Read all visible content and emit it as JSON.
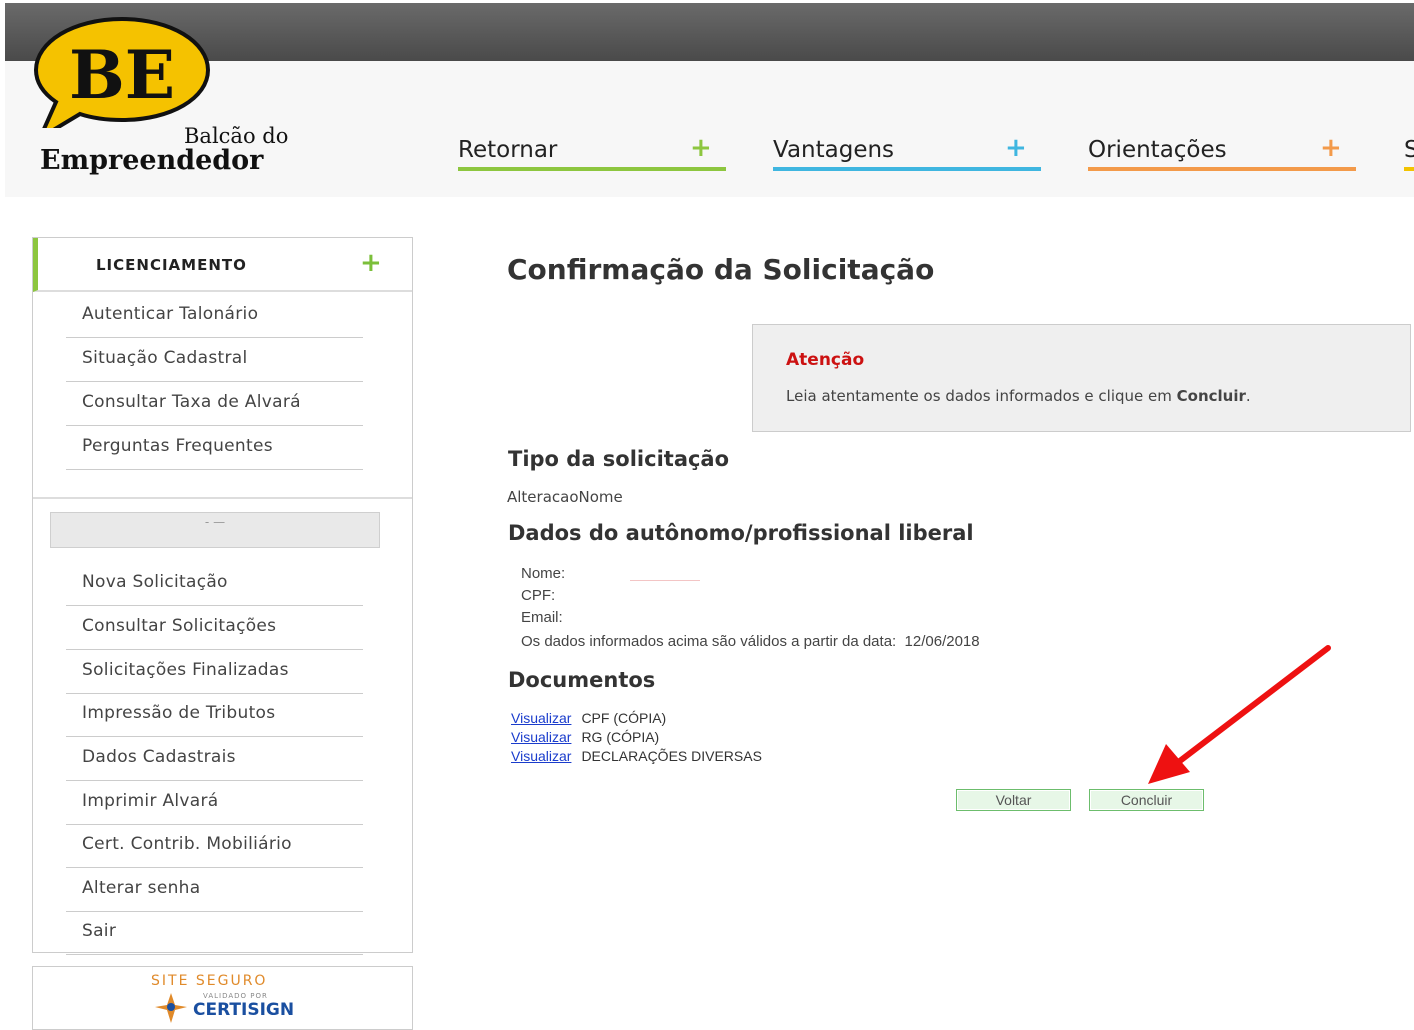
{
  "logo": {
    "mark": "BE",
    "line1": "Balcão do",
    "line2": "Empreendedor"
  },
  "nav": {
    "items": [
      {
        "label": "Retornar",
        "color": "#8dc63f"
      },
      {
        "label": "Vantagens",
        "color": "#3fb6e0"
      },
      {
        "label": "Orientações",
        "color": "#f39a4a"
      },
      {
        "label": "S",
        "color": "#f2c300"
      }
    ],
    "plus": "+"
  },
  "sidebar": {
    "title": "LICENCIAMENTO",
    "plus": "+",
    "top_items": [
      "Autenticar Talonário",
      "Situação Cadastral",
      "Consultar Taxa de Alvará",
      "Perguntas Frequentes"
    ],
    "grey_box_text": "- —",
    "bottom_items": [
      "Nova Solicitação",
      "Consultar Solicitações",
      "Solicitações Finalizadas",
      "Impressão de Tributos",
      "Dados Cadastrais",
      "Imprimir Alvará",
      "Cert. Contrib. Mobiliário",
      "Alterar senha",
      "Sair"
    ]
  },
  "secure_seal": {
    "title": "SITE SEGURO",
    "small": "VALIDADO POR",
    "brand": "CERTISIGN"
  },
  "main": {
    "title": "Confirmação da Solicitação",
    "alert": {
      "title": "Atenção",
      "message_prefix": "Leia atentamente os dados informados e clique em ",
      "message_bold": "Concluir",
      "message_suffix": "."
    },
    "tipo_heading": "Tipo da solicitação",
    "tipo_value": "AlteracaoNome",
    "dados_heading": "Dados do autônomo/profissional liberal",
    "nome_label": "Nome:",
    "cpf_label": "CPF:",
    "email_label": "Email:",
    "validity_text": "Os dados informados acima são válidos a partir da data:  12/06/2018",
    "documentos_heading": "Documentos",
    "documents": [
      {
        "link": "Visualizar",
        "name": "CPF (CÓPIA)"
      },
      {
        "link": "Visualizar",
        "name": "RG (CÓPIA)"
      },
      {
        "link": "Visualizar",
        "name": "DECLARAÇÕES DIVERSAS"
      }
    ],
    "buttons": {
      "back": "Voltar",
      "finish": "Concluir"
    }
  }
}
